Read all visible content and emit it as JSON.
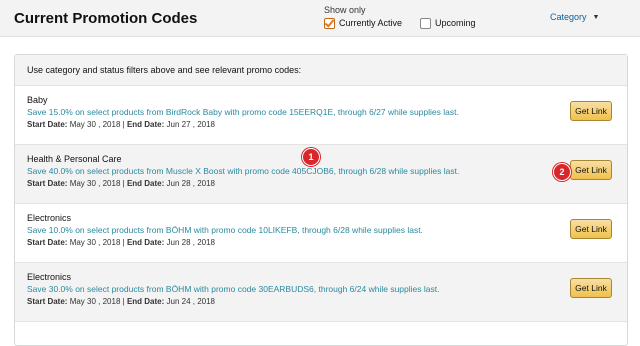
{
  "header": {
    "title": "Current Promotion Codes",
    "show_only_label": "Show only",
    "filters": [
      {
        "label": "Currently Active",
        "checked": true
      },
      {
        "label": "Upcoming",
        "checked": false
      }
    ],
    "category_label": "Category"
  },
  "instructions": "Use category and status filters above and see relevant promo codes:",
  "promotions": [
    {
      "category": "Baby",
      "description": "Save 15.0% on select products from BirdRock Baby with promo code 15EERQ1E, through 6/27 while supplies last.",
      "start_label": "Start Date:",
      "start_date": "May 30 , 2018",
      "separator": "|",
      "end_label": "End Date:",
      "end_date": "Jun 27 , 2018",
      "button": "Get Link"
    },
    {
      "category": "Health & Personal Care",
      "description": "Save 40.0% on select products from Muscle X Boost with promo code 405CJOB6, through 6/28 while supplies last.",
      "start_label": "Start Date:",
      "start_date": "May 30 , 2018",
      "separator": "|",
      "end_label": "End Date:",
      "end_date": "Jun 28 , 2018",
      "button": "Get Link"
    },
    {
      "category": "Electronics",
      "description": "Save 10.0% on select products from BÖHM with promo code 10LIKEFB, through 6/28 while supplies last.",
      "start_label": "Start Date:",
      "start_date": "May 30 , 2018",
      "separator": "|",
      "end_label": "End Date:",
      "end_date": "Jun 28 , 2018",
      "button": "Get Link"
    },
    {
      "category": "Electronics",
      "description": "Save 30.0% on select products from BÖHM with promo code 30EARBUDS6, through 6/24 while supplies last.",
      "start_label": "Start Date:",
      "start_date": "May 30 , 2018",
      "separator": "|",
      "end_label": "End Date:",
      "end_date": "Jun 24 , 2018",
      "button": "Get Link"
    }
  ],
  "markers": [
    "1",
    "2"
  ],
  "colors": {
    "accent_link": "#2a8a9e",
    "button": "#f0c14b",
    "marker": "#d9262a",
    "category_link": "#0f5f9a"
  },
  "icons": {
    "checkbox_checked": "checkmark-icon",
    "category_caret": "caret-down-icon"
  }
}
